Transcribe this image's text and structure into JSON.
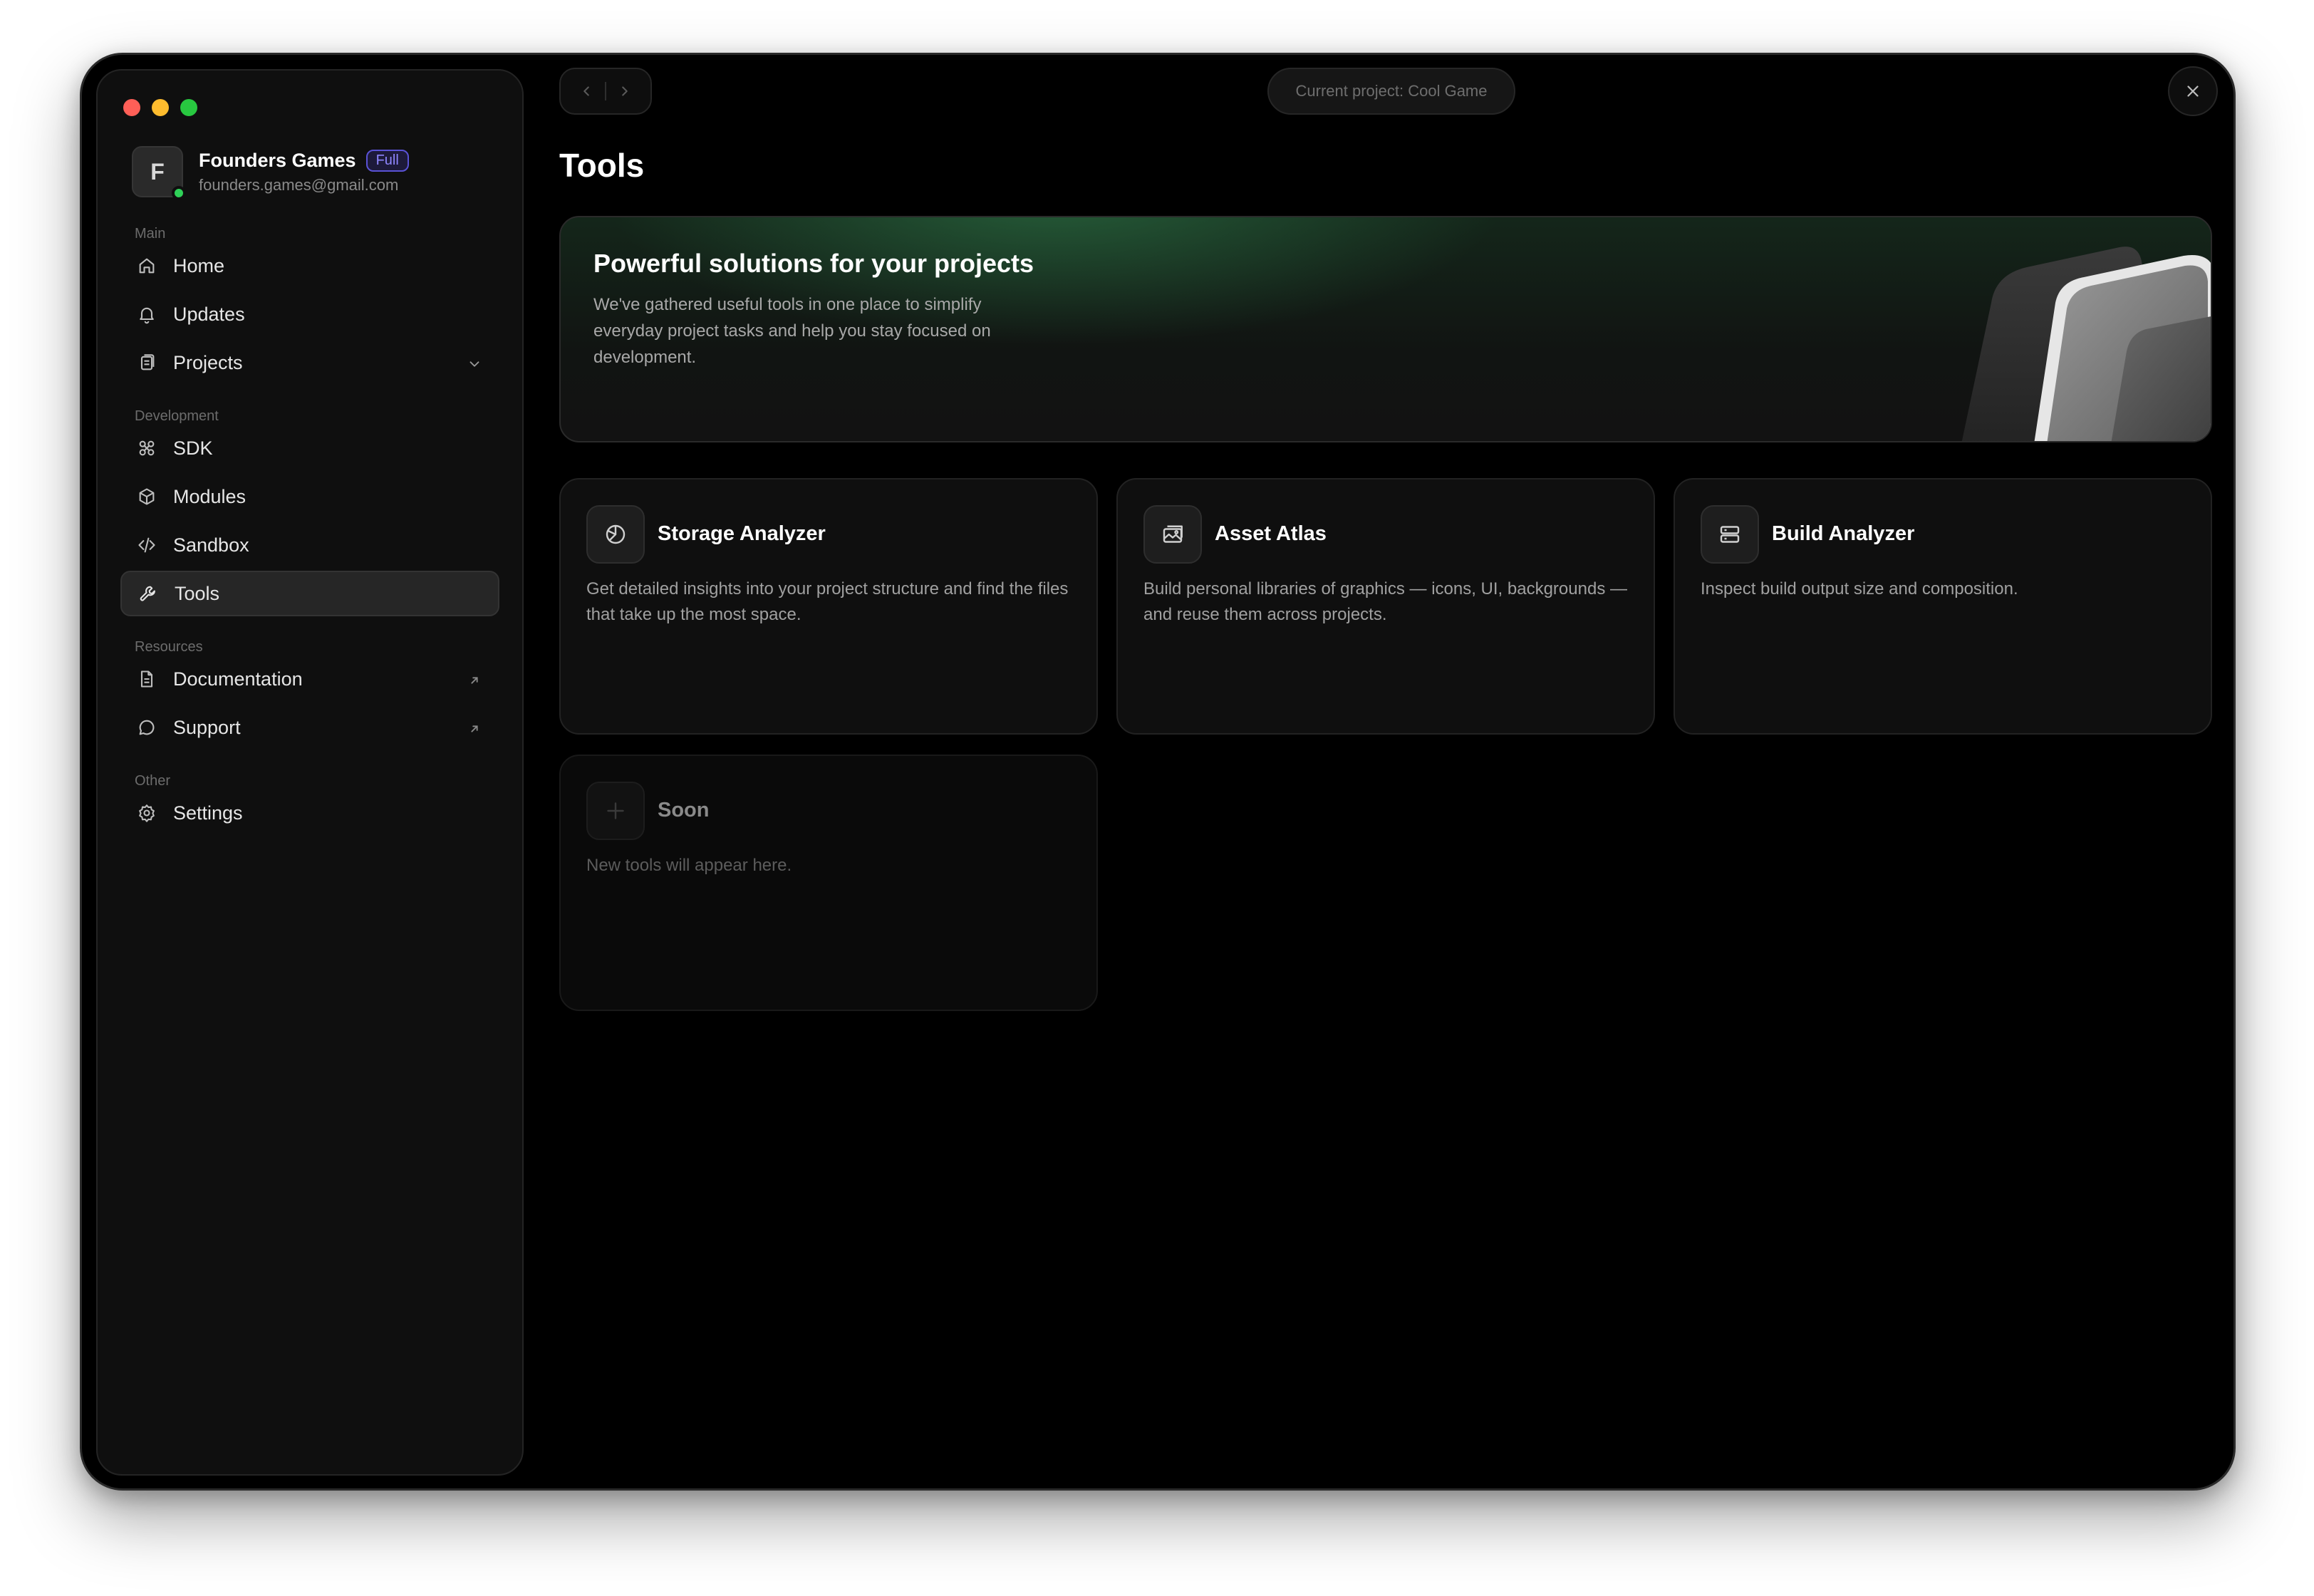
{
  "window": {
    "title": "Tools"
  },
  "profile": {
    "initial": "F",
    "name": "Founders Games",
    "plan": "Full",
    "email": "founders.games@gmail.com"
  },
  "sidebar": {
    "sections": {
      "main": "Main",
      "development": "Development",
      "resources": "Resources",
      "other": "Other"
    },
    "items": {
      "home": "Home",
      "updates": "Updates",
      "projects": "Projects",
      "sdk": "SDK",
      "modules": "Modules",
      "sandbox": "Sandbox",
      "tools": "Tools",
      "documentation": "Documentation",
      "support": "Support",
      "settings": "Settings"
    },
    "active": "tools"
  },
  "topbar": {
    "current_project": "Current project: Cool Game"
  },
  "page": {
    "title": "Tools"
  },
  "hero": {
    "title": "Powerful solutions for your projects",
    "text": "We've gathered useful tools in one place to simplify everyday project tasks and help you stay focused on development."
  },
  "tools": [
    {
      "title": "Storage Analyzer",
      "desc": "Get detailed insights into your project structure and find the files that take up the most space.",
      "icon": "pie-chart-icon"
    },
    {
      "title": "Asset Atlas",
      "desc": "Build personal libraries of graphics — icons, UI, backgrounds — and reuse them across projects.",
      "icon": "image-gallery-icon"
    },
    {
      "title": "Build Analyzer",
      "desc": "Inspect build output size and composition.",
      "icon": "server-icon"
    },
    {
      "title": "Soon",
      "desc": "New tools will appear here.",
      "icon": "plus-icon"
    }
  ],
  "colors": {
    "background": "#000000",
    "sidebar": "#0f0f0f",
    "accent_green": "#2fd158",
    "plan_badge": "#8f86ff"
  }
}
